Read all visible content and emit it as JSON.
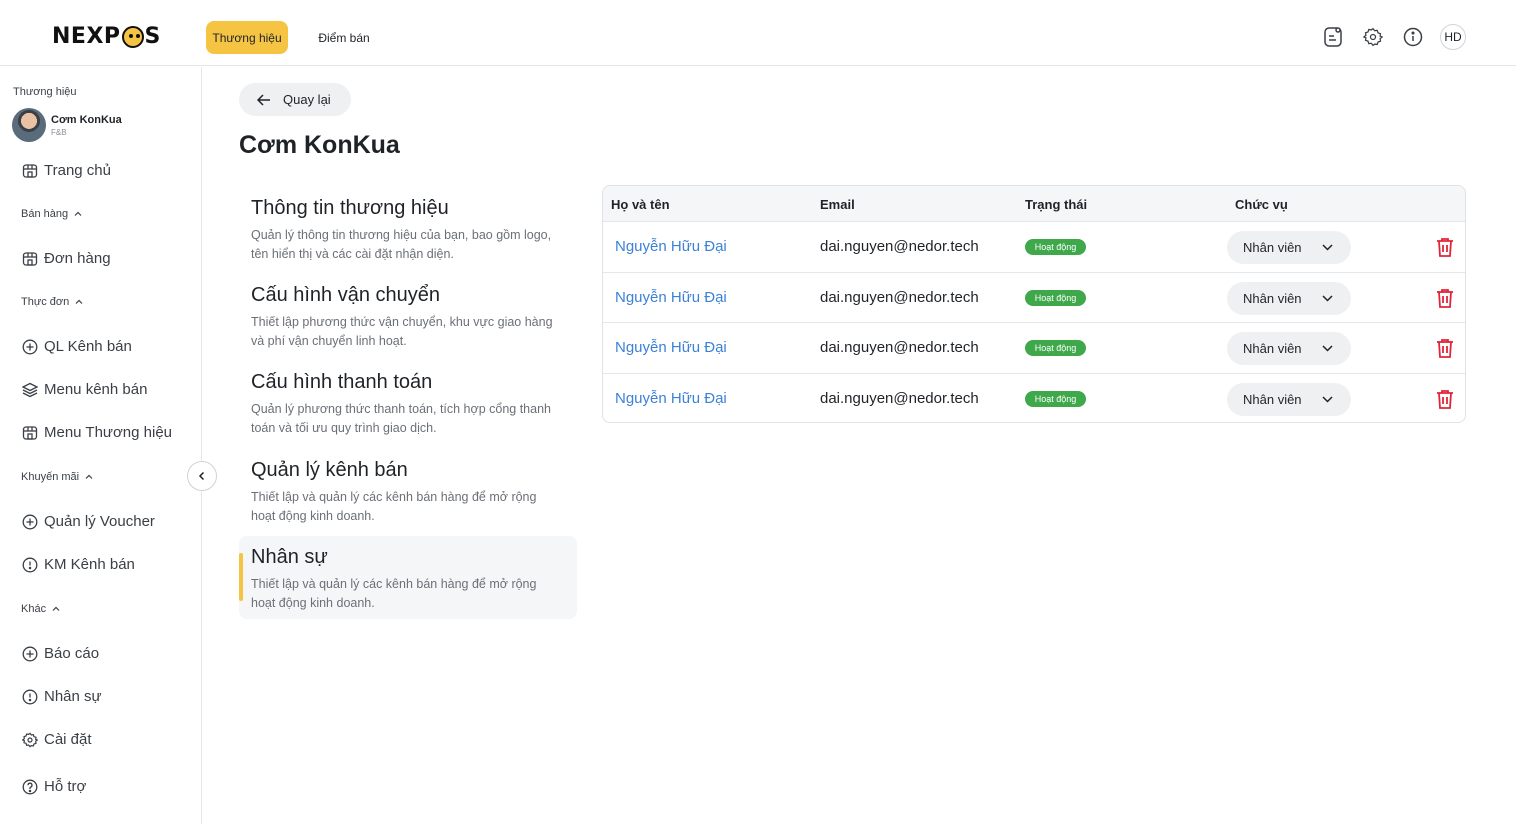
{
  "header": {
    "logo_text_left": "NEXP",
    "logo_text_right": "S",
    "tabs": [
      {
        "label": "Thương hiệu",
        "active": true
      },
      {
        "label": "Điểm bán",
        "active": false
      }
    ],
    "user_initials": "HD",
    "accent_color": "#f5c443"
  },
  "sidebar": {
    "brand_label": "Thương hiệu",
    "brand_name": "Cơm KonKua",
    "brand_category": "F&B",
    "home": "Trang chủ",
    "groups": {
      "sales": "Bán hàng",
      "menu": "Thực đơn",
      "promo": "Khuyến mãi",
      "other": "Khác"
    },
    "items": {
      "orders": "Đơn hàng",
      "channels": "QL Kênh bán",
      "channel_menu": "Menu kênh bán",
      "brand_menu": "Menu Thương hiệu",
      "vouchers": "Quản lý Voucher",
      "channel_promo": "KM Kênh bán",
      "reports": "Báo cáo",
      "staff": "Nhân sự",
      "settings": "Cài đặt",
      "support": "Hỗ trợ"
    }
  },
  "main": {
    "back_label": "Quay lại",
    "title": "Cơm KonKua",
    "sections": [
      {
        "title": "Thông tin thương hiệu",
        "desc1": "Quản lý thông tin thương hiệu của bạn, bao gồm logo,",
        "desc2": "tên hiển thị và các cài đặt nhận diện."
      },
      {
        "title": "Cấu hình vận chuyển",
        "desc1": "Thiết lập phương thức vận chuyển, khu vực giao hàng",
        "desc2": "và phí vận chuyển linh hoạt."
      },
      {
        "title": "Cấu hình thanh toán",
        "desc1": "Quản lý phương thức thanh toán, tích hợp cổng thanh",
        "desc2": "toán và tối ưu quy trình giao dịch."
      },
      {
        "title": "Quản lý kênh bán",
        "desc1": "Thiết lập và quản lý các kênh bán hàng để mở rộng",
        "desc2": "hoạt động kinh doanh."
      },
      {
        "title": "Nhân sự",
        "desc1": "Thiết lập và quản lý các kênh bán hàng để mở rộng",
        "desc2": "hoạt động kinh doanh.",
        "active": true
      }
    ],
    "table": {
      "columns": [
        "Họ và tên",
        "Email",
        "Trạng thái",
        "Chức vụ"
      ],
      "rows": [
        {
          "name": "Nguyễn Hữu Đại",
          "email": "dai.nguyen@nedor.tech",
          "status": "Hoạt động",
          "role": "Nhân viên"
        },
        {
          "name": "Nguyễn Hữu Đại",
          "email": "dai.nguyen@nedor.tech",
          "status": "Hoạt động",
          "role": "Nhân viên"
        },
        {
          "name": "Nguyễn Hữu Đại",
          "email": "dai.nguyen@nedor.tech",
          "status": "Hoạt động",
          "role": "Nhân viên"
        },
        {
          "name": "Nguyễn Hữu Đại",
          "email": "dai.nguyen@nedor.tech",
          "status": "Hoạt động",
          "role": "Nhân viên"
        }
      ],
      "status_color": "#3ea84b",
      "link_color": "#3b82d6",
      "delete_color": "#e0243a"
    }
  }
}
